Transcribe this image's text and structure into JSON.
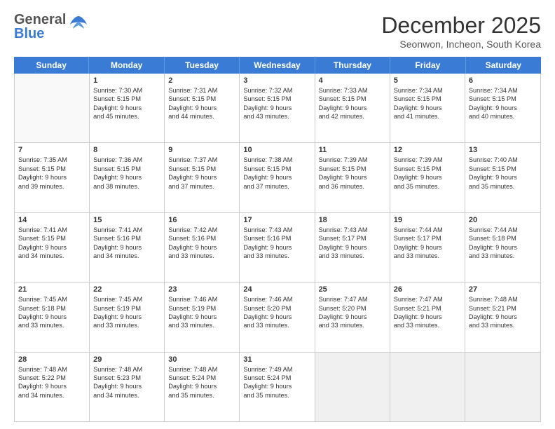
{
  "header": {
    "logo_general": "General",
    "logo_blue": "Blue",
    "month_title": "December 2025",
    "location": "Seonwon, Incheon, South Korea"
  },
  "weekdays": [
    "Sunday",
    "Monday",
    "Tuesday",
    "Wednesday",
    "Thursday",
    "Friday",
    "Saturday"
  ],
  "rows": [
    [
      {
        "day": "",
        "lines": [],
        "empty": true
      },
      {
        "day": "1",
        "lines": [
          "Sunrise: 7:30 AM",
          "Sunset: 5:15 PM",
          "Daylight: 9 hours",
          "and 45 minutes."
        ]
      },
      {
        "day": "2",
        "lines": [
          "Sunrise: 7:31 AM",
          "Sunset: 5:15 PM",
          "Daylight: 9 hours",
          "and 44 minutes."
        ]
      },
      {
        "day": "3",
        "lines": [
          "Sunrise: 7:32 AM",
          "Sunset: 5:15 PM",
          "Daylight: 9 hours",
          "and 43 minutes."
        ]
      },
      {
        "day": "4",
        "lines": [
          "Sunrise: 7:33 AM",
          "Sunset: 5:15 PM",
          "Daylight: 9 hours",
          "and 42 minutes."
        ]
      },
      {
        "day": "5",
        "lines": [
          "Sunrise: 7:34 AM",
          "Sunset: 5:15 PM",
          "Daylight: 9 hours",
          "and 41 minutes."
        ]
      },
      {
        "day": "6",
        "lines": [
          "Sunrise: 7:34 AM",
          "Sunset: 5:15 PM",
          "Daylight: 9 hours",
          "and 40 minutes."
        ]
      }
    ],
    [
      {
        "day": "7",
        "lines": [
          "Sunrise: 7:35 AM",
          "Sunset: 5:15 PM",
          "Daylight: 9 hours",
          "and 39 minutes."
        ]
      },
      {
        "day": "8",
        "lines": [
          "Sunrise: 7:36 AM",
          "Sunset: 5:15 PM",
          "Daylight: 9 hours",
          "and 38 minutes."
        ]
      },
      {
        "day": "9",
        "lines": [
          "Sunrise: 7:37 AM",
          "Sunset: 5:15 PM",
          "Daylight: 9 hours",
          "and 37 minutes."
        ]
      },
      {
        "day": "10",
        "lines": [
          "Sunrise: 7:38 AM",
          "Sunset: 5:15 PM",
          "Daylight: 9 hours",
          "and 37 minutes."
        ]
      },
      {
        "day": "11",
        "lines": [
          "Sunrise: 7:39 AM",
          "Sunset: 5:15 PM",
          "Daylight: 9 hours",
          "and 36 minutes."
        ]
      },
      {
        "day": "12",
        "lines": [
          "Sunrise: 7:39 AM",
          "Sunset: 5:15 PM",
          "Daylight: 9 hours",
          "and 35 minutes."
        ]
      },
      {
        "day": "13",
        "lines": [
          "Sunrise: 7:40 AM",
          "Sunset: 5:15 PM",
          "Daylight: 9 hours",
          "and 35 minutes."
        ]
      }
    ],
    [
      {
        "day": "14",
        "lines": [
          "Sunrise: 7:41 AM",
          "Sunset: 5:15 PM",
          "Daylight: 9 hours",
          "and 34 minutes."
        ]
      },
      {
        "day": "15",
        "lines": [
          "Sunrise: 7:41 AM",
          "Sunset: 5:16 PM",
          "Daylight: 9 hours",
          "and 34 minutes."
        ]
      },
      {
        "day": "16",
        "lines": [
          "Sunrise: 7:42 AM",
          "Sunset: 5:16 PM",
          "Daylight: 9 hours",
          "and 33 minutes."
        ]
      },
      {
        "day": "17",
        "lines": [
          "Sunrise: 7:43 AM",
          "Sunset: 5:16 PM",
          "Daylight: 9 hours",
          "and 33 minutes."
        ]
      },
      {
        "day": "18",
        "lines": [
          "Sunrise: 7:43 AM",
          "Sunset: 5:17 PM",
          "Daylight: 9 hours",
          "and 33 minutes."
        ]
      },
      {
        "day": "19",
        "lines": [
          "Sunrise: 7:44 AM",
          "Sunset: 5:17 PM",
          "Daylight: 9 hours",
          "and 33 minutes."
        ]
      },
      {
        "day": "20",
        "lines": [
          "Sunrise: 7:44 AM",
          "Sunset: 5:18 PM",
          "Daylight: 9 hours",
          "and 33 minutes."
        ]
      }
    ],
    [
      {
        "day": "21",
        "lines": [
          "Sunrise: 7:45 AM",
          "Sunset: 5:18 PM",
          "Daylight: 9 hours",
          "and 33 minutes."
        ]
      },
      {
        "day": "22",
        "lines": [
          "Sunrise: 7:45 AM",
          "Sunset: 5:19 PM",
          "Daylight: 9 hours",
          "and 33 minutes."
        ]
      },
      {
        "day": "23",
        "lines": [
          "Sunrise: 7:46 AM",
          "Sunset: 5:19 PM",
          "Daylight: 9 hours",
          "and 33 minutes."
        ]
      },
      {
        "day": "24",
        "lines": [
          "Sunrise: 7:46 AM",
          "Sunset: 5:20 PM",
          "Daylight: 9 hours",
          "and 33 minutes."
        ]
      },
      {
        "day": "25",
        "lines": [
          "Sunrise: 7:47 AM",
          "Sunset: 5:20 PM",
          "Daylight: 9 hours",
          "and 33 minutes."
        ]
      },
      {
        "day": "26",
        "lines": [
          "Sunrise: 7:47 AM",
          "Sunset: 5:21 PM",
          "Daylight: 9 hours",
          "and 33 minutes."
        ]
      },
      {
        "day": "27",
        "lines": [
          "Sunrise: 7:48 AM",
          "Sunset: 5:21 PM",
          "Daylight: 9 hours",
          "and 33 minutes."
        ]
      }
    ],
    [
      {
        "day": "28",
        "lines": [
          "Sunrise: 7:48 AM",
          "Sunset: 5:22 PM",
          "Daylight: 9 hours",
          "and 34 minutes."
        ]
      },
      {
        "day": "29",
        "lines": [
          "Sunrise: 7:48 AM",
          "Sunset: 5:23 PM",
          "Daylight: 9 hours",
          "and 34 minutes."
        ]
      },
      {
        "day": "30",
        "lines": [
          "Sunrise: 7:48 AM",
          "Sunset: 5:24 PM",
          "Daylight: 9 hours",
          "and 35 minutes."
        ]
      },
      {
        "day": "31",
        "lines": [
          "Sunrise: 7:49 AM",
          "Sunset: 5:24 PM",
          "Daylight: 9 hours",
          "and 35 minutes."
        ]
      },
      {
        "day": "",
        "lines": [],
        "empty": true,
        "shaded": true
      },
      {
        "day": "",
        "lines": [],
        "empty": true,
        "shaded": true
      },
      {
        "day": "",
        "lines": [],
        "empty": true,
        "shaded": true
      }
    ]
  ]
}
